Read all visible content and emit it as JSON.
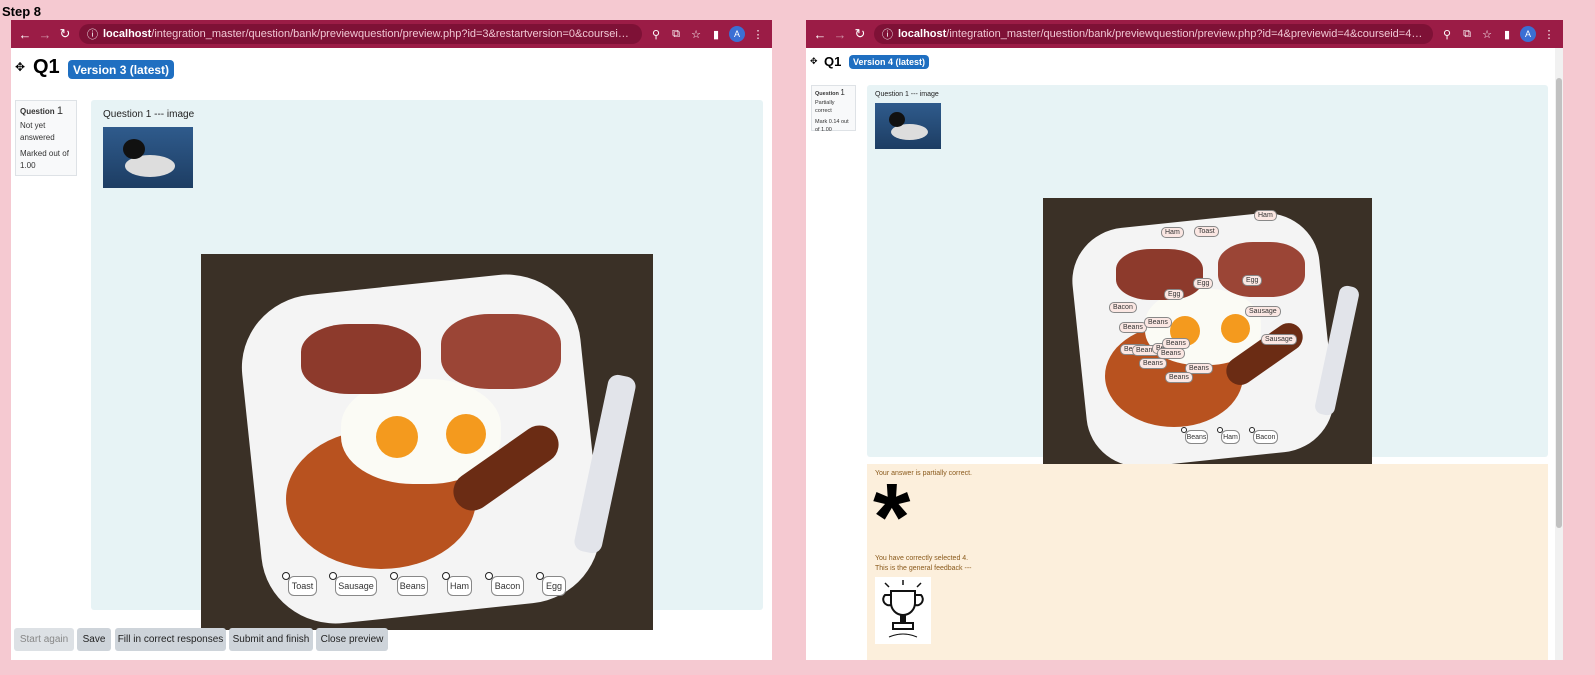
{
  "step_label": "Step 8",
  "left": {
    "url_host": "localhost",
    "url_path": "/integration_master/question/bank/previewquestion/preview.php?id=3&restartversion=0&courseid=4&returnurl=%2...",
    "avatar": "A",
    "q_label": "Q1",
    "version": "Version 3 (latest)",
    "info_title": "Question",
    "info_num": "1",
    "info_state": "Not yet answered",
    "info_mark": "Marked out of 1.00",
    "question_text": "Question 1 --- image",
    "drags": [
      "Toast",
      "Sausage",
      "Beans",
      "Ham",
      "Bacon",
      "Egg"
    ],
    "buttons": {
      "start": "Start again",
      "save": "Save",
      "fill": "Fill in correct responses",
      "submit": "Submit and finish",
      "close": "Close preview"
    }
  },
  "right": {
    "url_host": "localhost",
    "url_path": "/integration_master/question/bank/previewquestion/preview.php?id=4&previewid=4&courseid=4&returnurl=http%...",
    "avatar": "A",
    "q_label": "Q1",
    "version": "Version 4 (latest)",
    "info_title": "Question",
    "info_num": "1",
    "info_state": "Partially correct",
    "info_mark": "Mark 0.14 out of 1.00",
    "question_text": "Question 1 --- image",
    "placed": [
      "Ham",
      "Toast",
      "Ham",
      "Egg",
      "Egg",
      "Egg",
      "Sausage",
      "Bacon",
      "Beans",
      "Beans",
      "Sausage",
      "Beans",
      "Beans",
      "Beans",
      "Beans",
      "Beans",
      "Beans",
      "Beans",
      "Beans"
    ],
    "remaining": [
      "Beans",
      "Ham",
      "Bacon"
    ],
    "feedback_partial": "Your answer is partially correct.",
    "feedback_selected": "You have correctly selected 4.",
    "feedback_general": "This is the general feedback ---",
    "asterisk": "*"
  },
  "colors": {
    "chrome": "#9b1c46",
    "badge": "#1f6fc1",
    "formulation": "#e7f3f5",
    "feedback": "#fcefdc"
  }
}
